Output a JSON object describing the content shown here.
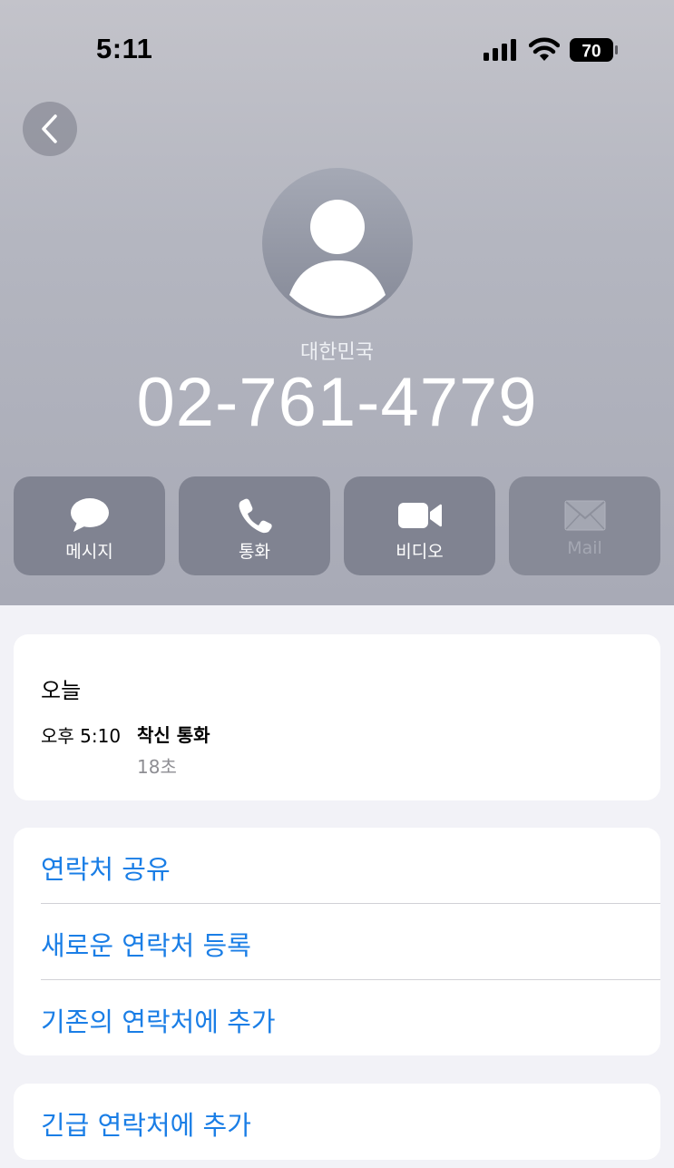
{
  "status_bar": {
    "time": "5:11",
    "battery": "70"
  },
  "contact": {
    "country": "대한민국",
    "phone": "02-761-4779"
  },
  "actions": [
    {
      "label": "메시지",
      "icon": "message-bubble-icon"
    },
    {
      "label": "통화",
      "icon": "phone-icon"
    },
    {
      "label": "비디오",
      "icon": "video-camera-icon"
    },
    {
      "label": "Mail",
      "icon": "mail-icon",
      "disabled": true
    }
  ],
  "history": {
    "title": "오늘",
    "time": "오후 5:10",
    "type": "착신 통화",
    "duration": "18초"
  },
  "options": [
    "연락처 공유",
    "새로운 연락처 등록",
    "기존의 연락처에 추가"
  ],
  "emergency": "긴급 연락처에 추가",
  "colors": {
    "link": "#1a7ee6",
    "action_bg": "#808391"
  }
}
